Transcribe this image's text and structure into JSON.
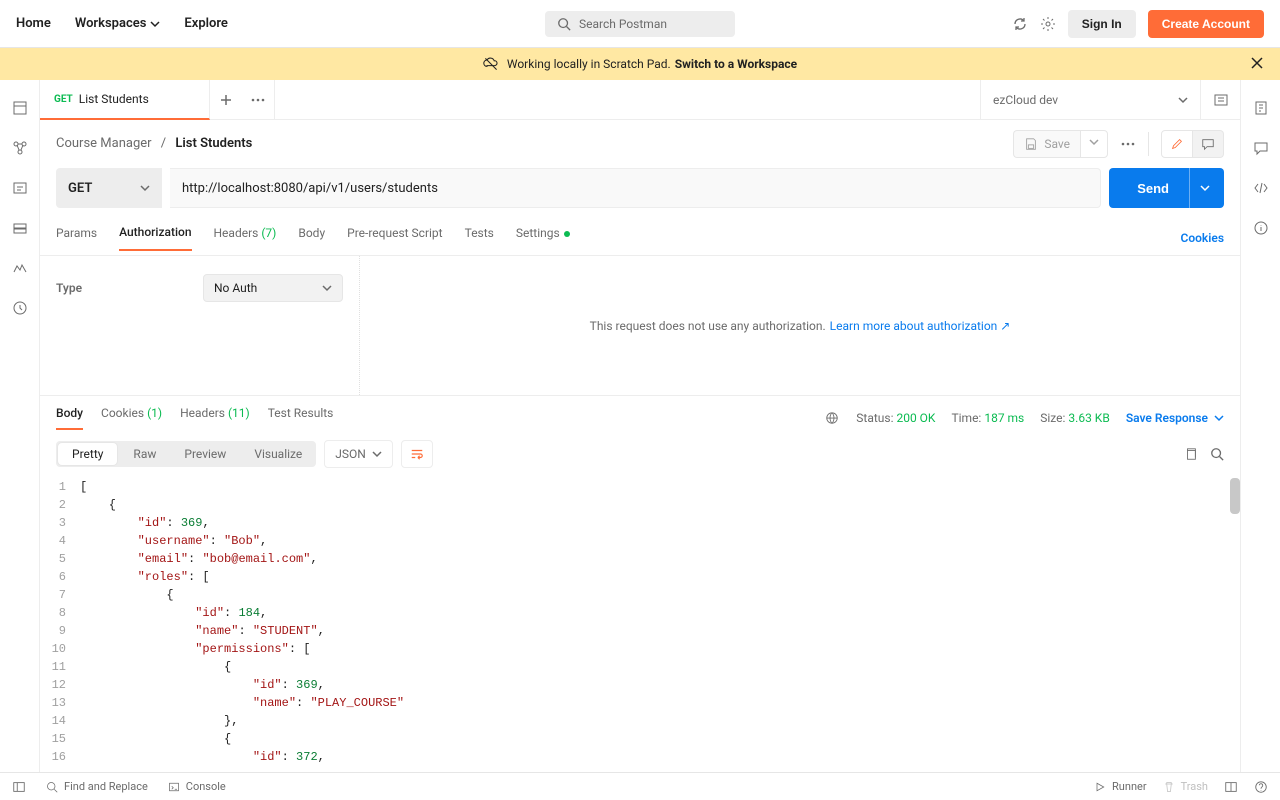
{
  "header": {
    "nav": {
      "home": "Home",
      "workspaces": "Workspaces",
      "explore": "Explore"
    },
    "search_placeholder": "Search Postman",
    "signin": "Sign In",
    "create": "Create Account"
  },
  "banner": {
    "text": "Working locally in Scratch Pad. ",
    "link": "Switch to a Workspace"
  },
  "tab": {
    "method": "GET",
    "title": "List Students"
  },
  "env": {
    "name": "ezCloud dev"
  },
  "crumb": {
    "parent": "Course Manager",
    "sep": "/",
    "current": "List Students"
  },
  "actions": {
    "save": "Save"
  },
  "request": {
    "method": "GET",
    "url": "http://localhost:8080/api/v1/users/students",
    "send": "Send"
  },
  "subtabs": {
    "params": "Params",
    "auth": "Authorization",
    "headers": "Headers",
    "headers_count": "(7)",
    "body": "Body",
    "prereq": "Pre-request Script",
    "tests": "Tests",
    "settings": "Settings",
    "cookies": "Cookies"
  },
  "auth": {
    "type_label": "Type",
    "type_value": "No Auth",
    "msg": "This request does not use any authorization. ",
    "link": "Learn more about authorization ↗"
  },
  "resp_tabs": {
    "body": "Body",
    "cookies": "Cookies",
    "cookies_count": "(1)",
    "headers": "Headers",
    "headers_count": "(11)",
    "tests": "Test Results"
  },
  "resp_status": {
    "status_lbl": "Status:",
    "status_val": "200 OK",
    "time_lbl": "Time:",
    "time_val": "187 ms",
    "size_lbl": "Size:",
    "size_val": "3.63 KB",
    "save": "Save Response"
  },
  "resp_views": {
    "pretty": "Pretty",
    "raw": "Raw",
    "preview": "Preview",
    "visualize": "Visualize",
    "fmt": "JSON"
  },
  "json_lines": [
    {
      "n": 1,
      "html": "<span class='p'>[</span>"
    },
    {
      "n": 2,
      "html": "<span class='p'>    {</span>"
    },
    {
      "n": 3,
      "html": "        <span class='k'>\"id\"</span><span class='p'>: </span><span class='n'>369</span><span class='p'>,</span>"
    },
    {
      "n": 4,
      "html": "        <span class='k'>\"username\"</span><span class='p'>: </span><span class='k'>\"Bob\"</span><span class='p'>,</span>"
    },
    {
      "n": 5,
      "html": "        <span class='k'>\"email\"</span><span class='p'>: </span><span class='k'>\"bob@email.com\"</span><span class='p'>,</span>"
    },
    {
      "n": 6,
      "html": "        <span class='k'>\"roles\"</span><span class='p'>: [</span>"
    },
    {
      "n": 7,
      "html": "<span class='p'>            {</span>"
    },
    {
      "n": 8,
      "html": "                <span class='k'>\"id\"</span><span class='p'>: </span><span class='n'>184</span><span class='p'>,</span>"
    },
    {
      "n": 9,
      "html": "                <span class='k'>\"name\"</span><span class='p'>: </span><span class='k'>\"STUDENT\"</span><span class='p'>,</span>"
    },
    {
      "n": 10,
      "html": "                <span class='k'>\"permissions\"</span><span class='p'>: [</span>"
    },
    {
      "n": 11,
      "html": "<span class='p'>                    {</span>"
    },
    {
      "n": 12,
      "html": "                        <span class='k'>\"id\"</span><span class='p'>: </span><span class='n'>369</span><span class='p'>,</span>"
    },
    {
      "n": 13,
      "html": "                        <span class='k'>\"name\"</span><span class='p'>: </span><span class='k'>\"PLAY_COURSE\"</span>"
    },
    {
      "n": 14,
      "html": "<span class='p'>                    },</span>"
    },
    {
      "n": 15,
      "html": "<span class='p'>                    {</span>"
    },
    {
      "n": 16,
      "html": "                        <span class='k'>\"id\"</span><span class='p'>: </span><span class='n'>372</span><span class='p'>,</span>"
    }
  ],
  "statusbar": {
    "find": "Find and Replace",
    "console": "Console",
    "runner": "Runner",
    "trash": "Trash"
  }
}
